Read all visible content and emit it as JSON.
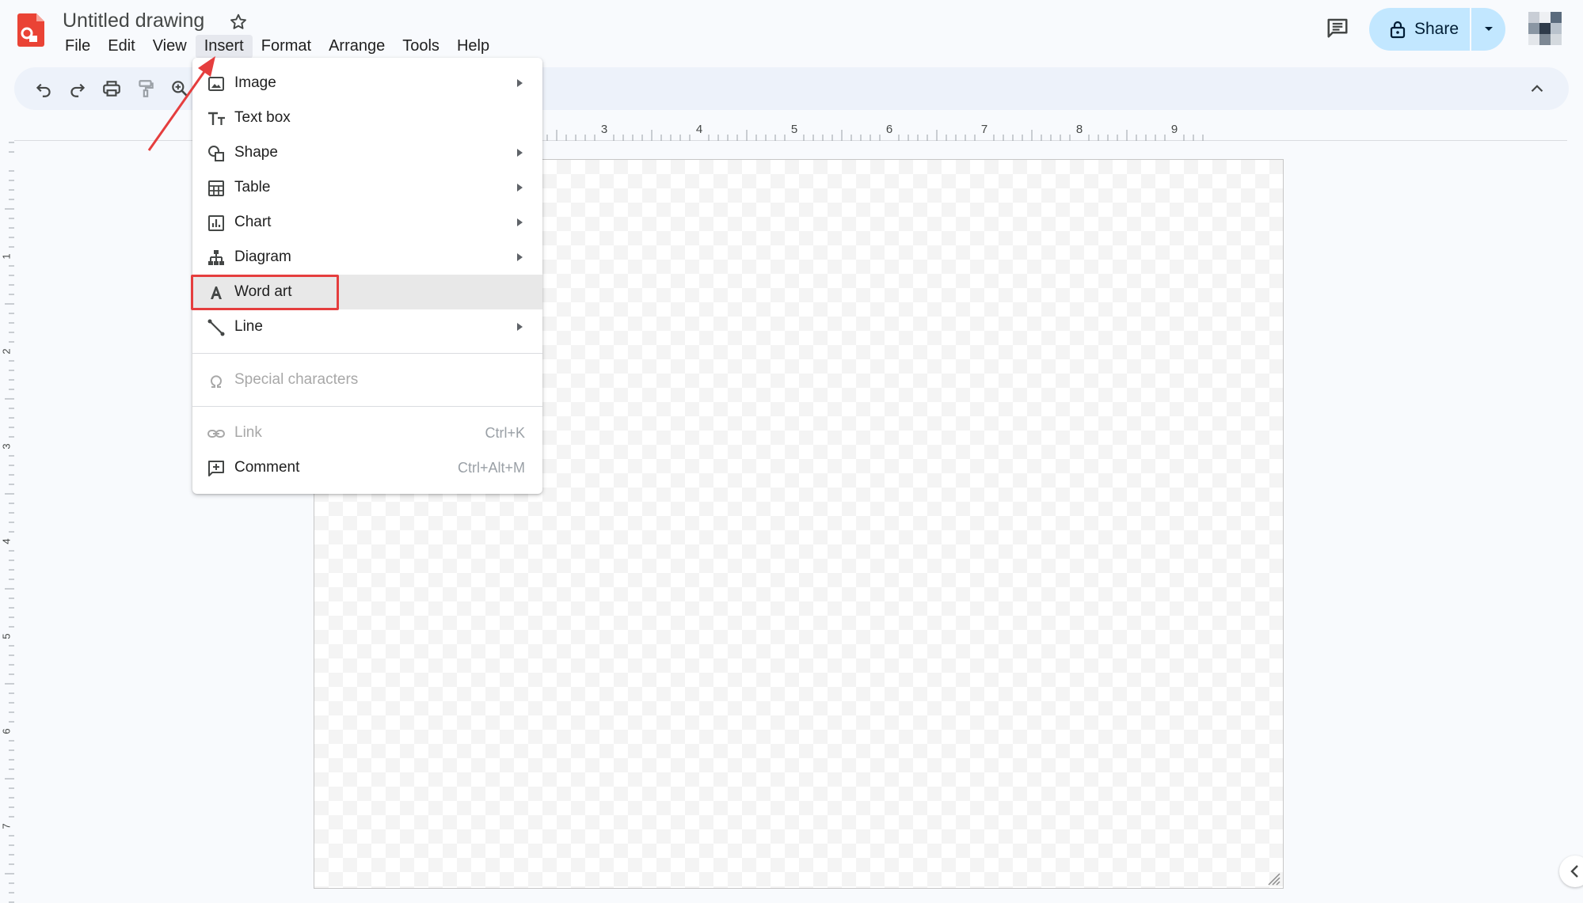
{
  "app": {
    "doc_title": "Untitled drawing",
    "brand_color": "#ea4335"
  },
  "menubar": [
    {
      "label": "File",
      "name": "menu-file"
    },
    {
      "label": "Edit",
      "name": "menu-edit"
    },
    {
      "label": "View",
      "name": "menu-view"
    },
    {
      "label": "Insert",
      "name": "menu-insert",
      "active": true
    },
    {
      "label": "Format",
      "name": "menu-format"
    },
    {
      "label": "Arrange",
      "name": "menu-arrange"
    },
    {
      "label": "Tools",
      "name": "menu-tools"
    },
    {
      "label": "Help",
      "name": "menu-help"
    }
  ],
  "header": {
    "share_label": "Share",
    "share_color": "#c2e7ff"
  },
  "toolbar": {
    "icons": [
      "undo-icon",
      "redo-icon",
      "print-icon",
      "paint-format-icon",
      "zoom-icon"
    ]
  },
  "ruler": {
    "h_labels": [
      "3",
      "4",
      "5",
      "6",
      "7",
      "8",
      "9"
    ],
    "v_labels": [
      "1",
      "2",
      "3",
      "4",
      "5",
      "6",
      "7"
    ]
  },
  "insert_menu": {
    "items": [
      {
        "label": "Image",
        "icon": "image-icon",
        "submenu": true
      },
      {
        "label": "Text box",
        "icon": "text-box-icon",
        "submenu": false
      },
      {
        "label": "Shape",
        "icon": "shape-icon",
        "submenu": true
      },
      {
        "label": "Table",
        "icon": "table-icon",
        "submenu": true
      },
      {
        "label": "Chart",
        "icon": "chart-icon",
        "submenu": true
      },
      {
        "label": "Diagram",
        "icon": "diagram-icon",
        "submenu": true
      },
      {
        "label": "Word art",
        "icon": "word-art-icon",
        "submenu": false,
        "hover": true,
        "highlighted": true
      },
      {
        "label": "Line",
        "icon": "line-icon",
        "submenu": true
      },
      {
        "label": "Special characters",
        "icon": "omega-icon",
        "disabled": true
      },
      {
        "label": "Link",
        "icon": "link-icon",
        "disabled": true,
        "shortcut": "Ctrl+K"
      },
      {
        "label": "Comment",
        "icon": "comment-add-icon",
        "shortcut": "Ctrl+Alt+M"
      }
    ]
  },
  "annotation": {
    "color": "#e53e3e"
  }
}
